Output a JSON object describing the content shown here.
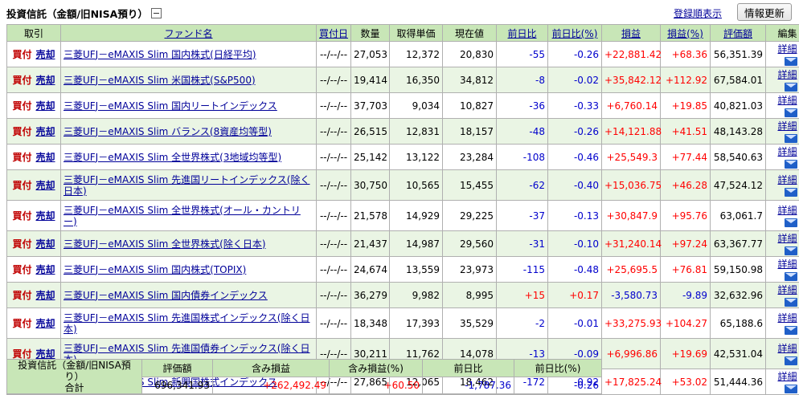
{
  "header": {
    "title": "投資信託（金額/旧NISA預り）",
    "sort_link": "登録順表示",
    "refresh_button": "情報更新"
  },
  "table": {
    "columns": [
      "取引",
      "ファンド名",
      "買付日",
      "数量",
      "取得単価",
      "現在値",
      "前日比",
      "前日比(%)",
      "損益",
      "損益(%)",
      "評価額",
      "編集"
    ],
    "buy_label": "買付",
    "sell_label": "売却",
    "detail_label": "詳細",
    "rows": [
      {
        "fund": "三菱UFJ－eMAXIS Slim 国内株式(日経平均)",
        "date": "--/--/--",
        "qty": "27,053",
        "cost": "12,372",
        "price": "20,830",
        "chg": "-55",
        "chg_pct": "-0.26",
        "pl": "+22,881.42",
        "pl_pct": "+68.36",
        "value": "56,351.39"
      },
      {
        "fund": "三菱UFJ－eMAXIS Slim 米国株式(S&P500)",
        "date": "--/--/--",
        "qty": "19,414",
        "cost": "16,350",
        "price": "34,812",
        "chg": "-8",
        "chg_pct": "-0.02",
        "pl": "+35,842.12",
        "pl_pct": "+112.92",
        "value": "67,584.01"
      },
      {
        "fund": "三菱UFJ－eMAXIS Slim 国内リートインデックス",
        "date": "--/--/--",
        "qty": "37,703",
        "cost": "9,034",
        "price": "10,827",
        "chg": "-36",
        "chg_pct": "-0.33",
        "pl": "+6,760.14",
        "pl_pct": "+19.85",
        "value": "40,821.03"
      },
      {
        "fund": "三菱UFJ－eMAXIS Slim バランス(8資産均等型)",
        "date": "--/--/--",
        "qty": "26,515",
        "cost": "12,831",
        "price": "18,157",
        "chg": "-48",
        "chg_pct": "-0.26",
        "pl": "+14,121.88",
        "pl_pct": "+41.51",
        "value": "48,143.28"
      },
      {
        "fund": "三菱UFJ－eMAXIS Slim 全世界株式(3地域均等型)",
        "date": "--/--/--",
        "qty": "25,142",
        "cost": "13,122",
        "price": "23,284",
        "chg": "-108",
        "chg_pct": "-0.46",
        "pl": "+25,549.3",
        "pl_pct": "+77.44",
        "value": "58,540.63"
      },
      {
        "fund": "三菱UFJ－eMAXIS Slim 先進国リートインデックス(除く日本)",
        "date": "--/--/--",
        "qty": "30,750",
        "cost": "10,565",
        "price": "15,455",
        "chg": "-62",
        "chg_pct": "-0.40",
        "pl": "+15,036.75",
        "pl_pct": "+46.28",
        "value": "47,524.12"
      },
      {
        "fund": "三菱UFJ－eMAXIS Slim 全世界株式(オール・カントリー)",
        "date": "--/--/--",
        "qty": "21,578",
        "cost": "14,929",
        "price": "29,225",
        "chg": "-37",
        "chg_pct": "-0.13",
        "pl": "+30,847.9",
        "pl_pct": "+95.76",
        "value": "63,061.7"
      },
      {
        "fund": "三菱UFJ－eMAXIS Slim 全世界株式(除く日本)",
        "date": "--/--/--",
        "qty": "21,437",
        "cost": "14,987",
        "price": "29,560",
        "chg": "-31",
        "chg_pct": "-0.10",
        "pl": "+31,240.14",
        "pl_pct": "+97.24",
        "value": "63,367.77"
      },
      {
        "fund": "三菱UFJ－eMAXIS Slim 国内株式(TOPIX)",
        "date": "--/--/--",
        "qty": "24,674",
        "cost": "13,559",
        "price": "23,973",
        "chg": "-115",
        "chg_pct": "-0.48",
        "pl": "+25,695.5",
        "pl_pct": "+76.81",
        "value": "59,150.98"
      },
      {
        "fund": "三菱UFJ－eMAXIS Slim 国内債券インデックス",
        "date": "--/--/--",
        "qty": "36,279",
        "cost": "9,982",
        "price": "8,995",
        "chg": "+15",
        "chg_pct": "+0.17",
        "pl": "-3,580.73",
        "pl_pct": "-9.89",
        "value": "32,632.96"
      },
      {
        "fund": "三菱UFJ－eMAXIS Slim 先進国株式インデックス(除く日本)",
        "date": "--/--/--",
        "qty": "18,348",
        "cost": "17,393",
        "price": "35,529",
        "chg": "-2",
        "chg_pct": "-0.01",
        "pl": "+33,275.93",
        "pl_pct": "+104.27",
        "value": "65,188.6"
      },
      {
        "fund": "三菱UFJ－eMAXIS Slim 先進国債券インデックス(除く日本)",
        "date": "--/--/--",
        "qty": "30,211",
        "cost": "11,762",
        "price": "14,078",
        "chg": "-13",
        "chg_pct": "-0.09",
        "pl": "+6,996.86",
        "pl_pct": "+19.69",
        "value": "42,531.04"
      },
      {
        "fund": "三菱UFJ－eMAXIS Slim 新興国株式インデックス",
        "date": "--/--/--",
        "qty": "27,865",
        "cost": "12,065",
        "price": "18,462",
        "chg": "-172",
        "chg_pct": "-0.92",
        "pl": "+17,825.24",
        "pl_pct": "+53.02",
        "value": "51,444.36"
      }
    ]
  },
  "summary": {
    "label_line1": "投資信託（金額/旧NISA預り）",
    "label_line2": "合計",
    "columns": [
      "評価額",
      "含み損益",
      "含み損益(%)",
      "前日比",
      "前日比(%)"
    ],
    "values": [
      "696,341.93",
      "+262,492.49",
      "+60.50",
      "-1,787.36",
      "-0.26"
    ]
  },
  "colors": {
    "header_green": "#c8e6b7",
    "row_alt": "#eaf5e4",
    "positive": "#ff0000",
    "negative": "#0000cc",
    "link": "#000099"
  },
  "icons": {
    "collapse": "minus-box-icon",
    "mail": "envelope-icon"
  }
}
